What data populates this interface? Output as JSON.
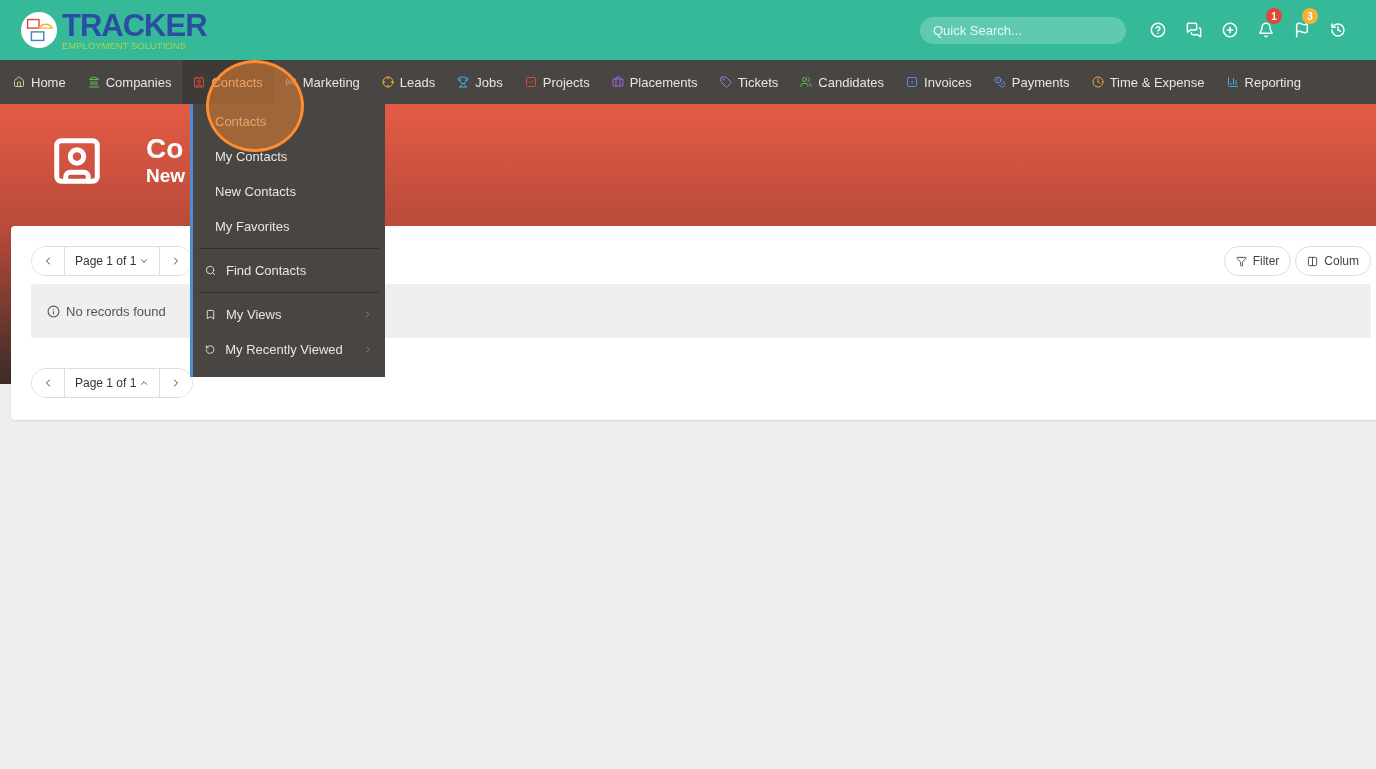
{
  "logo": {
    "name": "TRACKER",
    "tagline": "EMPLOYMENT SOLUTIONS"
  },
  "search": {
    "placeholder": "Quick Search..."
  },
  "alerts": [
    {
      "count": "1",
      "color": "#e0493a"
    },
    {
      "count": "3",
      "color": "#f0b43a"
    }
  ],
  "nav": [
    {
      "label": "Home",
      "selected": false
    },
    {
      "label": "Companies",
      "selected": false
    },
    {
      "label": "Contacts",
      "selected": true
    },
    {
      "label": "Marketing",
      "selected": false
    },
    {
      "label": "Leads",
      "selected": false
    },
    {
      "label": "Jobs",
      "selected": false
    },
    {
      "label": "Projects",
      "selected": false
    },
    {
      "label": "Placements",
      "selected": false
    },
    {
      "label": "Tickets",
      "selected": false
    },
    {
      "label": "Candidates",
      "selected": false
    },
    {
      "label": "Invoices",
      "selected": false
    },
    {
      "label": "Payments",
      "selected": false
    },
    {
      "label": "Time & Expense",
      "selected": false
    },
    {
      "label": "Reporting",
      "selected": false
    }
  ],
  "hero": {
    "title": "Co",
    "subtitle": "New"
  },
  "menu": [
    {
      "kind": "link",
      "label": "Contacts",
      "selected": true
    },
    {
      "kind": "link",
      "label": "My Contacts",
      "selected": false
    },
    {
      "kind": "link",
      "label": "New Contacts",
      "selected": false
    },
    {
      "kind": "link",
      "label": "My Favorites",
      "selected": false
    },
    {
      "kind": "search",
      "label": "Find Contacts",
      "selected": false
    },
    {
      "kind": "bookmark",
      "label": "My Views",
      "selected": false
    },
    {
      "kind": "history",
      "label": "My Recently Viewed",
      "selected": false
    }
  ],
  "pager_top": {
    "label": "Page 1 of 1",
    "open": false
  },
  "pager_bottom": {
    "label": "Page 1 of 1",
    "open": true
  },
  "toolbar": [
    "Filter",
    "Colum"
  ],
  "empty_message": "No records found"
}
